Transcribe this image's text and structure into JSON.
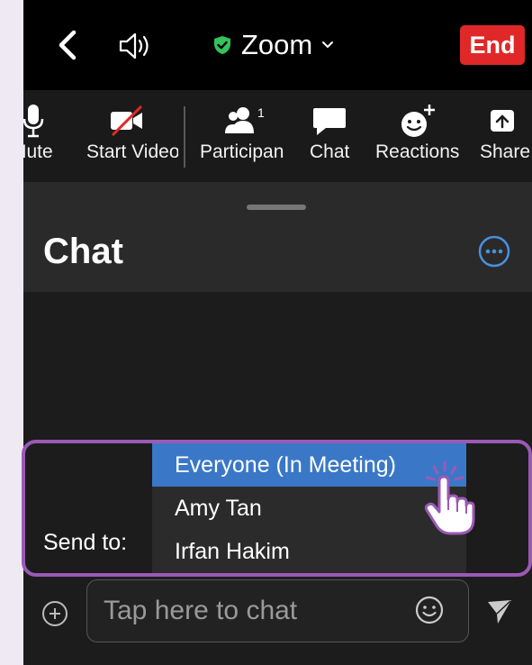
{
  "header": {
    "app_title": "Zoom",
    "end_label": "End"
  },
  "toolbar": {
    "items": [
      {
        "label": "Mute"
      },
      {
        "label": "Start Video"
      },
      {
        "label": "Participants",
        "count": "1"
      },
      {
        "label": "Chat"
      },
      {
        "label": "Reactions"
      },
      {
        "label": "Share"
      }
    ]
  },
  "chat": {
    "title": "Chat",
    "send_to_label": "Send to:",
    "recipients": [
      {
        "label": "Everyone (In Meeting)",
        "selected": true
      },
      {
        "label": "Amy Tan",
        "selected": false
      },
      {
        "label": "Irfan Hakim",
        "selected": false
      }
    ],
    "input_placeholder": "Tap here to chat"
  },
  "colors": {
    "end_button": "#e02828",
    "selected_item": "#3a78c7",
    "accent_link": "#4a8fe0",
    "highlight": "#9b59b6",
    "shield": "#33c25b"
  }
}
